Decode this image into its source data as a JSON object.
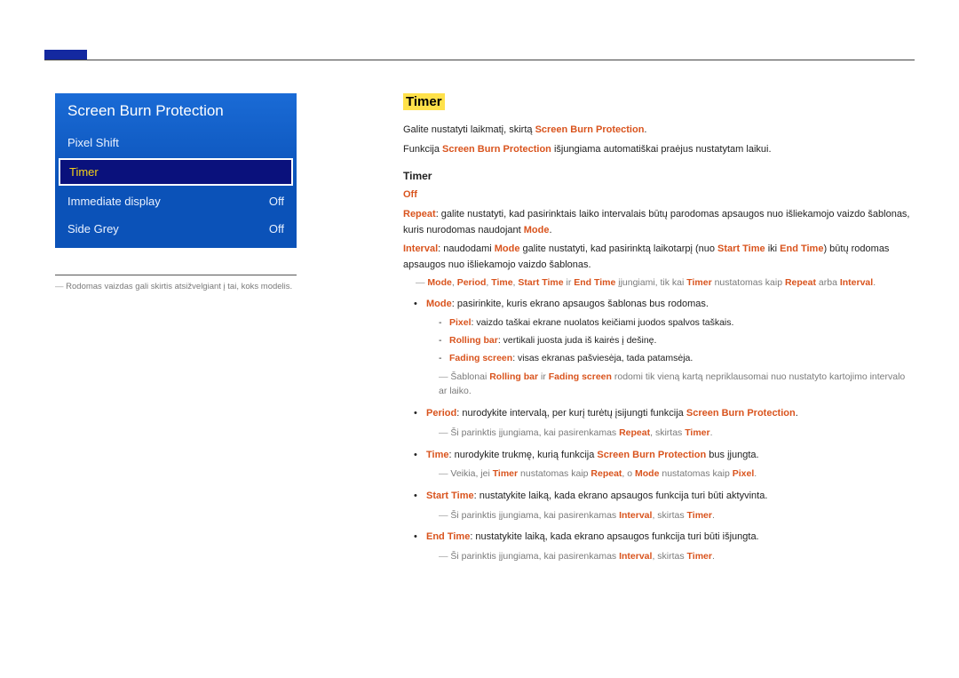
{
  "menu": {
    "title": "Screen Burn Protection",
    "items": [
      {
        "label": "Pixel Shift",
        "value": ""
      },
      {
        "label": "Timer",
        "value": ""
      },
      {
        "label": "Immediate display",
        "value": "Off"
      },
      {
        "label": "Side Grey",
        "value": "Off"
      }
    ]
  },
  "left_note": "Rodomas vaizdas gali skirtis atsižvelgiant į tai, koks modelis.",
  "section": {
    "title": "Timer",
    "p1a": "Galite nustatyti laikmatį, skirtą ",
    "p1b": "Screen Burn Protection",
    "p1c": ".",
    "p2a": "Funkcija ",
    "p2b": "Screen Burn Protection",
    "p2c": " išjungiama automatiškai praėjus nustatytam laikui.",
    "subtitle": "Timer",
    "off_label": "Off",
    "repeat_label": "Repeat",
    "repeat_text": ": galite nustatyti, kad pasirinktais laiko intervalais būtų parodomas apsaugos nuo išliekamojo vaizdo šablonas, kuris nurodomas naudojant ",
    "mode_word": "Mode",
    "dot": ".",
    "interval_label": "Interval",
    "interval_text_a": ": naudodami ",
    "interval_text_b": " galite nustatyti, kad pasirinktą laikotarpį (nuo ",
    "start_time": "Start Time",
    "iki": " iki ",
    "end_time": "End Time",
    "interval_text_c": ") būtų rodomas apsaugos nuo išliekamojo vaizdo šablonas.",
    "note_a1": "Mode",
    "note_a_sep": ", ",
    "note_a2": "Period",
    "note_a3": "Time",
    "note_a4": "Start Time",
    "note_a_ir": " ir ",
    "note_a5": "End Time",
    "note_a_txt1": " įjungiami, tik kai ",
    "note_a6": "Timer",
    "note_a_txt2": " nustatomas kaip ",
    "note_a7": "Repeat",
    "note_a_arba": " arba ",
    "note_a8": "Interval",
    "bullet_mode": ": pasirinkite, kuris ekrano apsaugos šablonas bus rodomas.",
    "dash_pixel_label": "Pixel",
    "dash_pixel": ": vaizdo taškai ekrane nuolatos keičiami juodos spalvos taškais.",
    "dash_rolling_label": "Rolling bar",
    "dash_rolling": ": vertikali juosta juda iš kairės į dešinę.",
    "dash_fading_label": "Fading screen",
    "dash_fading": ": visas ekranas pašviesėja, tada patamsėja.",
    "note_b_txt1": "Šablonai ",
    "note_b1": "Rolling bar",
    "note_b_ir": " ir ",
    "note_b2": "Fading screen",
    "note_b_txt2": " rodomi tik vieną kartą nepriklausomai nuo nustatyto kartojimo intervalo ar laiko.",
    "bullet_period_label": "Period",
    "bullet_period_a": ": nurodykite intervalą, per kurį turėtų įsijungti funkcija ",
    "sbp": "Screen Burn Protection",
    "note_c_txt1": "Ši parinktis įjungiama, kai pasirenkamas ",
    "note_c1": "Repeat",
    "note_c_txt2": ", skirtas ",
    "note_c2": "Timer",
    "bullet_time_label": "Time",
    "bullet_time_a": ": nurodykite trukmę, kurią funkcija ",
    "bullet_time_b": " bus įjungta.",
    "note_d_txt1": "Veikia, jei ",
    "note_d1": "Timer",
    "note_d_txt2": " nustatomas kaip ",
    "note_d2": "Repeat",
    "note_d_txt3": ", o ",
    "note_d3": "Mode",
    "note_d_txt4": " nustatomas kaip ",
    "note_d4": "Pixel",
    "bullet_start_label": "Start Time",
    "bullet_start": ": nustatykite laiką, kada ekrano apsaugos funkcija turi būti aktyvinta.",
    "note_e_txt1": "Ši parinktis įjungiama, kai pasirenkamas ",
    "note_e1": "Interval",
    "note_e_txt2": ", skirtas ",
    "note_e2": "Timer",
    "bullet_end_label": "End Time",
    "bullet_end": ": nustatykite laiką, kada ekrano apsaugos funkcija turi būti išjungta.",
    "note_f_txt1": "Ši parinktis įjungiama, kai pasirenkamas ",
    "note_f1": "Interval",
    "note_f_txt2": ", skirtas ",
    "note_f2": "Timer"
  }
}
